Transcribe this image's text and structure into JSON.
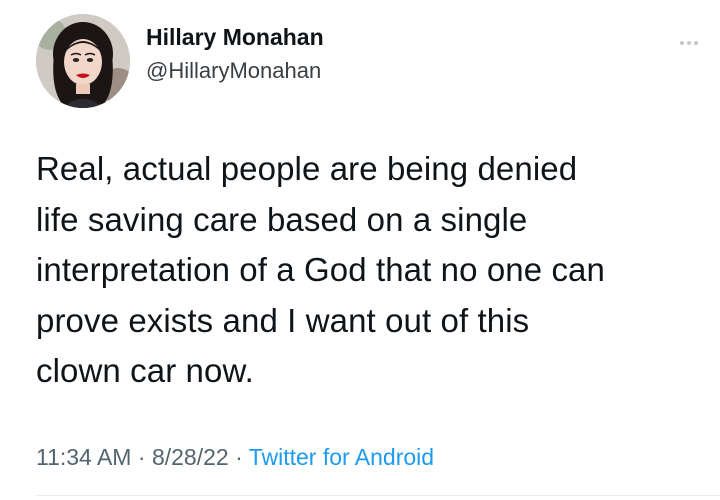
{
  "author": {
    "display_name": "Hillary Monahan",
    "handle": "@HillaryMonahan",
    "avatar_icon": "profile-photo"
  },
  "menu": {
    "icon": "more-horizontal-icon"
  },
  "tweet": {
    "text": "Real, actual people are being denied\nlife saving care based on a single\ninterpretation of a God that no one can\nprove exists and I want out of this\nclown car now."
  },
  "meta": {
    "time": "11:34 AM",
    "separator_1": " · ",
    "date": "8/28/22",
    "separator_2": " · ",
    "source": "Twitter for Android"
  },
  "colors": {
    "text": "#0f1419",
    "secondary": "#536471",
    "link": "#1d9bf0"
  }
}
